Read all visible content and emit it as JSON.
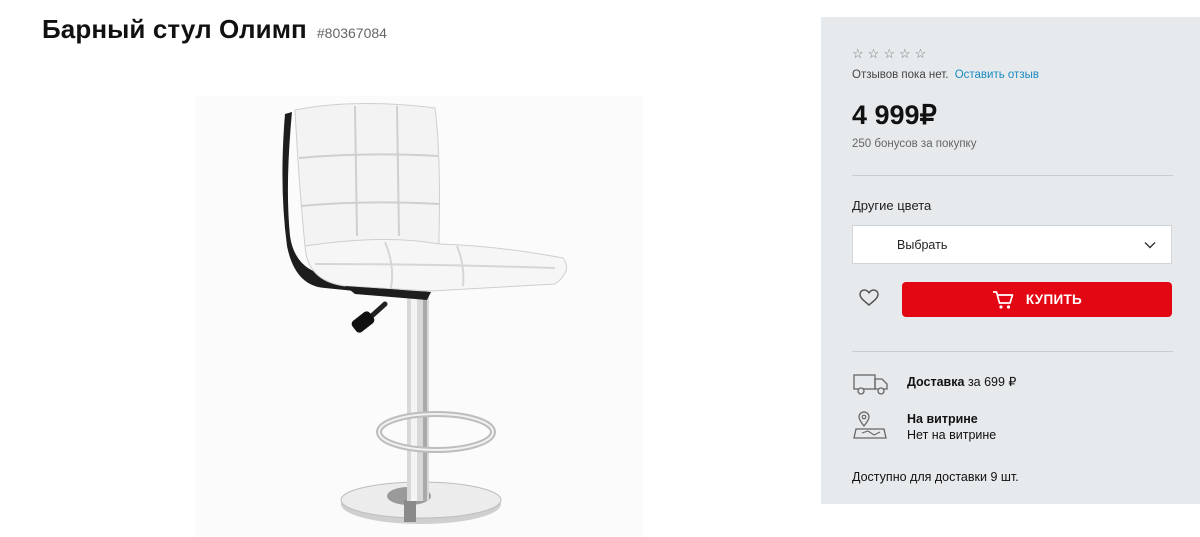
{
  "product": {
    "title": "Барный стул Олимп",
    "sku": "#80367084",
    "image_alt": "chair-photo"
  },
  "panel": {
    "rating_stars": 0,
    "reviews_text": "Отзывов пока нет.",
    "leave_review": "Оставить отзыв",
    "price": "4 999₽",
    "bonus": "250 бонусов за покупку",
    "other_colors_label": "Другие цвета",
    "select_value": "Выбрать",
    "buy_label": "КУПИТЬ",
    "delivery_title": "Доставка",
    "delivery_price": "за 699 ₽",
    "showcase_title": "На витрине",
    "showcase_status": "Нет на витрине",
    "availability": "Доступно для доставки 9 шт."
  },
  "colors": {
    "accent": "#e30613",
    "panel_bg": "#e6eaec",
    "link": "#1a8ac0"
  },
  "icons": {
    "star": "star-outline-icon",
    "chevron": "chevron-down-icon",
    "favorite": "heart-icon",
    "cart": "cart-icon",
    "truck": "truck-icon",
    "map_pin": "map-pin-icon"
  }
}
